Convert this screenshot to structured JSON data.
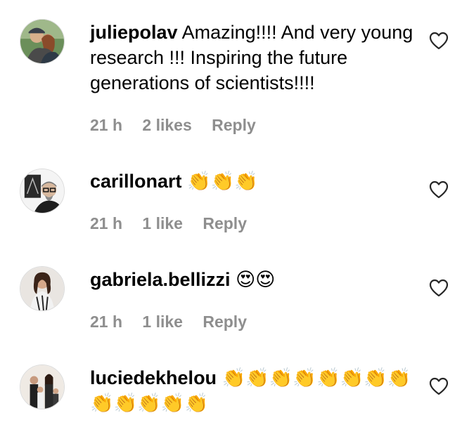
{
  "comments": [
    {
      "username": "juliepolav",
      "text": "Amazing!!!! And very young research !!! Inspiring the future generations of scientists!!!!",
      "time": "21 h",
      "likes": "2 likes",
      "reply": "Reply",
      "avatar_icon": "avatar-couple-photo"
    },
    {
      "username": "carillonart",
      "text": "👏👏👏",
      "time": "21 h",
      "likes": "1 like",
      "reply": "Reply",
      "avatar_icon": "avatar-man-glasses-photo"
    },
    {
      "username": "gabriela.bellizzi",
      "text": "😍😍",
      "time": "21 h",
      "likes": "1 like",
      "reply": "Reply",
      "avatar_icon": "avatar-woman-photo"
    },
    {
      "username": "luciedekhelou",
      "text": "👏👏👏👏👏👏👏👏👏👏👏👏👏",
      "time": "",
      "likes": "",
      "reply": "",
      "avatar_icon": "avatar-family-photo"
    }
  ],
  "icons": {
    "like": "heart-outline-icon"
  },
  "colors": {
    "text": "#000000",
    "meta": "#8e8e8e",
    "background": "#ffffff"
  }
}
